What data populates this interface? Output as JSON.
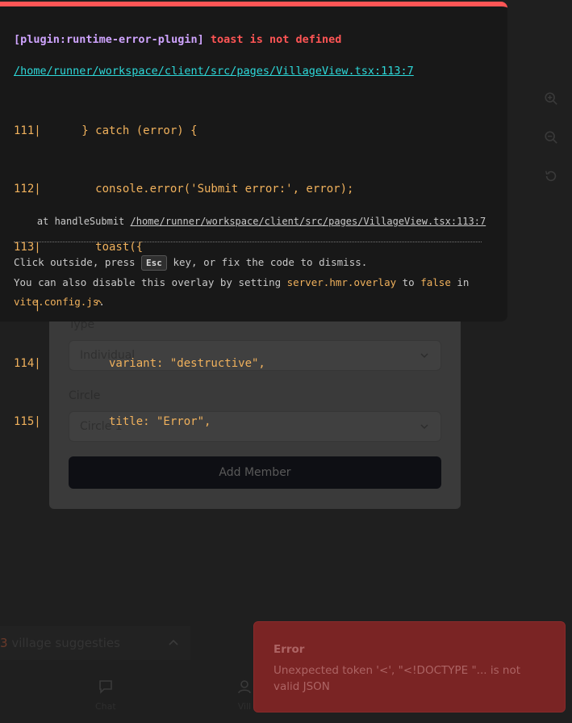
{
  "background_form": {
    "type_label": "Type",
    "type_value": "Individual",
    "circle_label": "Circle",
    "circle_value": "Circle 1",
    "add_member_label": "Add Member"
  },
  "side_tools": [
    "zoom-in-icon",
    "zoom-out-icon",
    "reset-icon"
  ],
  "suggestions": {
    "count": "3",
    "text": "village suggesties"
  },
  "bottom_nav": [
    {
      "label": "Chat",
      "icon": "chat-icon"
    },
    {
      "label": "Vill",
      "icon": "user-icon"
    }
  ],
  "error_overlay": {
    "plugin": "[plugin:runtime-error-plugin]",
    "message": "toast is not defined",
    "file": "/home/runner/workspace/client/src/pages/VillageView.tsx:113:7",
    "code_lines": [
      "111|      } catch (error) {",
      "112|        console.error('Submit error:', error);",
      "113|        toast({",
      "   |        ^",
      "114|          variant: \"destructive\",",
      "115|          title: \"Error\","
    ],
    "stack_prefix": "    at handleSubmit ",
    "stack_link": "/home/runner/workspace/client/src/pages/VillageView.tsx:113:7",
    "tip_1_a": "Click outside, press ",
    "tip_key": "Esc",
    "tip_1_b": " key, or fix the code to dismiss.",
    "tip_2_a": "You can also disable this overlay by setting ",
    "tip_code_1": "server.hmr.overlay",
    "tip_2_b": " to ",
    "tip_code_2": "false",
    "tip_2_c": " in ",
    "tip_code_3": "vite.config.js",
    "tip_2_d": "."
  },
  "toast": {
    "title": "Error",
    "description": "Unexpected token '<', \"<!DOCTYPE \"... is not valid JSON"
  },
  "colors": {
    "overlay_accent": "#ff5555",
    "code_text": "#f0b15c",
    "file_link": "#2dd9da",
    "plugin_text": "#cfa4ff",
    "toast_bg": "#7a2424"
  }
}
